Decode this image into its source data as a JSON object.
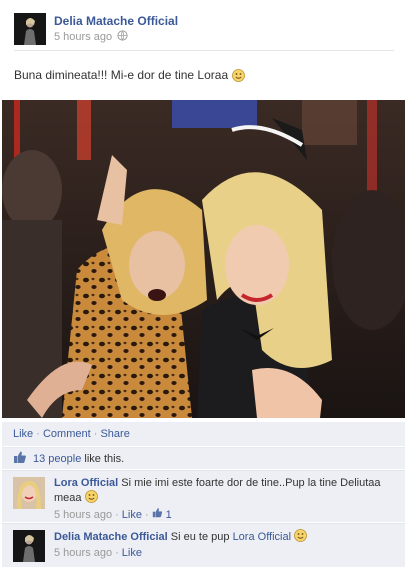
{
  "post": {
    "author": "Delia Matache Official",
    "time": "5 hours ago",
    "text": "Buna dimineata!!! Mi-e dor de tine Loraa",
    "actions": {
      "like": "Like",
      "comment": "Comment",
      "share": "Share",
      "separator": "·"
    },
    "likes": {
      "count_label": "13 people",
      "suffix": "like this."
    }
  },
  "comments": [
    {
      "author": "Lora Official",
      "text": "Si mie imi este foarte dor de tine..Pup la tine Deliutaa meaa",
      "time": "5 hours ago",
      "like_label": "Like",
      "like_count": "1",
      "separator": "·"
    },
    {
      "author": "Delia Matache Official",
      "text": "Si eu te pup",
      "mention": "Lora Official",
      "time": "5 hours ago",
      "like_label": "Like",
      "separator": "·"
    }
  ],
  "colors": {
    "link": "#3b5998",
    "meta": "#999999",
    "comment_bg": "#edeff4"
  }
}
